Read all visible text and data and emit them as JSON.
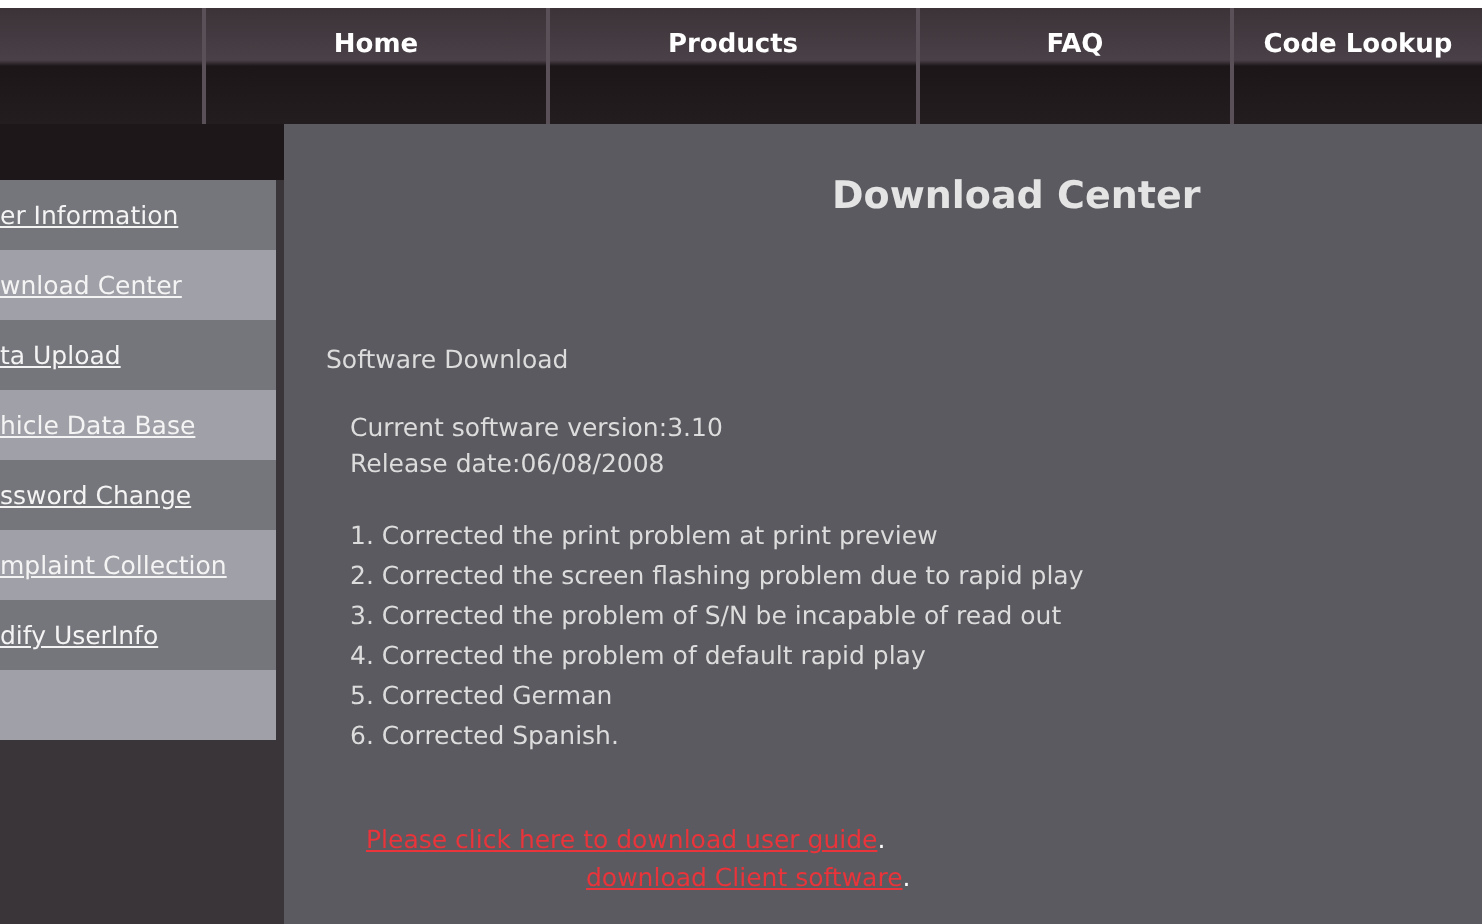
{
  "nav": {
    "items": [
      "Home",
      "Products",
      "FAQ",
      "Code Lookup"
    ]
  },
  "sidebar": {
    "items": [
      "er Information",
      "wnload Center",
      "ta Upload",
      "hicle Data Base",
      "ssword Change",
      "mplaint Collection",
      "dify UserInfo"
    ]
  },
  "content": {
    "title": "Download Center",
    "section": "Software Download",
    "info": [
      "Current software version:3.10",
      "Release date:06/08/2008"
    ],
    "changes": [
      "1. Corrected the print problem at print preview",
      "2. Corrected the screen flashing problem due to rapid play",
      "3. Corrected the problem of S/N be incapable of read out",
      "4. Corrected the problem of default rapid play",
      "5. Corrected German",
      "6. Corrected Spanish."
    ],
    "links": [
      {
        "text": "Please click here to download user guide",
        "after": "."
      },
      {
        "text": "download Client software",
        "after": "."
      }
    ]
  }
}
